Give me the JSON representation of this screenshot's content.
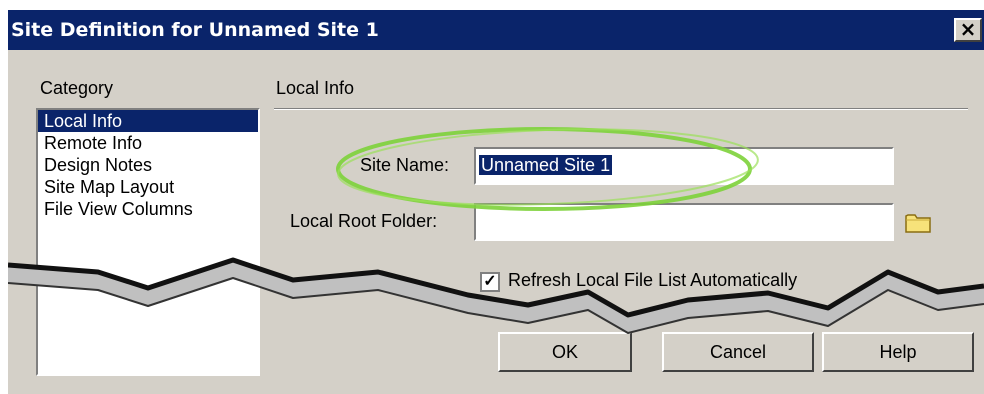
{
  "dialog": {
    "title": "Site Definition for Unnamed Site 1",
    "close_glyph": "×"
  },
  "category": {
    "heading": "Category",
    "items": [
      "Local Info",
      "Remote Info",
      "Design Notes",
      "Site Map Layout",
      "File View Columns"
    ],
    "selected": "Local Info"
  },
  "panel": {
    "heading": "Local Info",
    "site_name_label": "Site Name:",
    "site_name_value": "Unnamed Site 1",
    "root_folder_label": "Local Root Folder:",
    "root_folder_value": "",
    "folder_icon": "folder-icon",
    "checkbox_checked": true,
    "checkbox_label": "Refresh Local File List Automatically"
  },
  "buttons": {
    "ok": "OK",
    "cancel": "Cancel",
    "help": "Help"
  },
  "annotation": {
    "highlight_color": "#7dd13a",
    "highlight_target": "site-name"
  }
}
